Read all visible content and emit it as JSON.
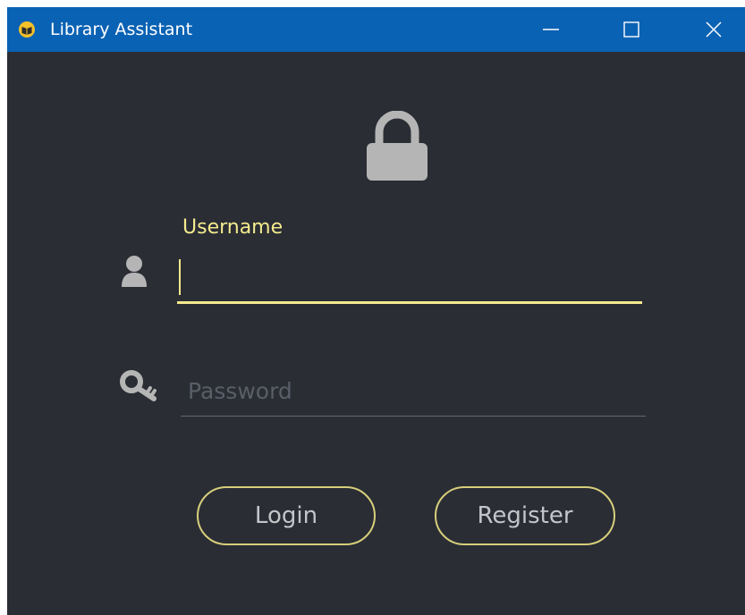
{
  "window": {
    "title": "Library Assistant",
    "titlebar_color": "#0a62b4",
    "background_color": "#2a2d34",
    "icons": {
      "app": "book-icon",
      "minimize": "minimize-icon",
      "maximize": "maximize-icon",
      "close": "close-icon"
    }
  },
  "form": {
    "header_icon": "lock-icon",
    "accent_color": "#f4ea8e",
    "username": {
      "icon": "user-icon",
      "label": "Username",
      "value": ""
    },
    "password": {
      "icon": "key-icon",
      "placeholder": "Password",
      "value": ""
    }
  },
  "buttons": {
    "login_label": "Login",
    "register_label": "Register"
  }
}
